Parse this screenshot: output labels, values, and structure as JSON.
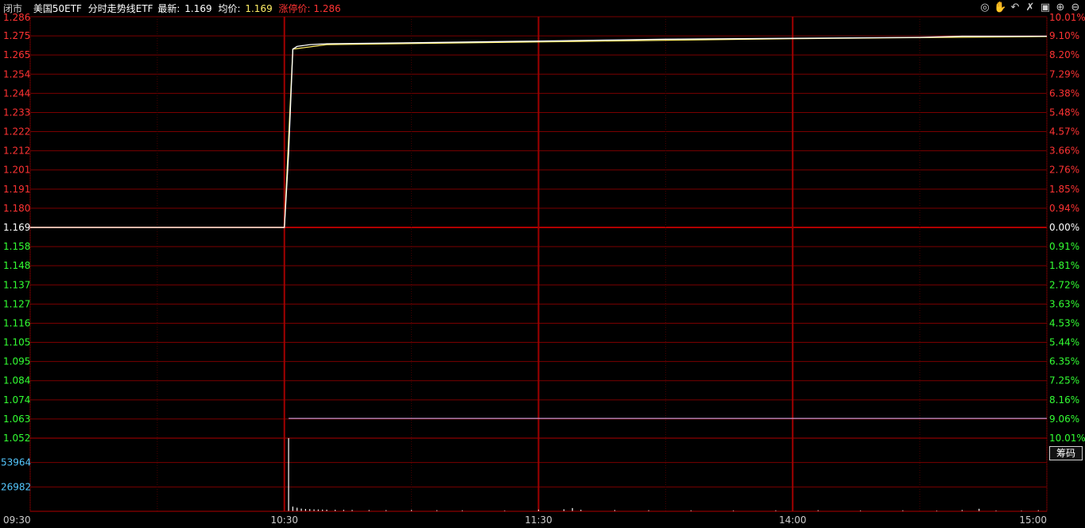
{
  "header": {
    "status": "闭市",
    "name": "美国50ETF",
    "view": "分时走势线ETF",
    "latest_label": "最新:",
    "latest_value": "1.169",
    "avg_label": "均价:",
    "avg_value": "1.169",
    "limit_label": "涨停价:",
    "limit_value": "1.286"
  },
  "toolbar": {
    "icons": [
      "eye-icon",
      "hand-icon",
      "undo-icon",
      "cross-icon",
      "lock-icon",
      "zoom-in-icon",
      "zoom-out-icon"
    ]
  },
  "chip_label": "筹码",
  "colors": {
    "up": "#ff3333",
    "down": "#33ff33",
    "flat": "#ffffff",
    "grid": "#7a0000",
    "price_line": "#ffffff",
    "avg_line": "#ffee66",
    "low_ref": "#d8b8ff",
    "volume_axis": "#55c8ff",
    "volume_bar": "#ffffff"
  },
  "chart_data": {
    "type": "line",
    "prev_close": 1.169,
    "limit_up": 1.286,
    "limit_down": 1.052,
    "price_ticks": [
      "1.286",
      "1.275",
      "1.265",
      "1.254",
      "1.244",
      "1.233",
      "1.222",
      "1.212",
      "1.201",
      "1.191",
      "1.180",
      "1.169",
      "1.158",
      "1.148",
      "1.137",
      "1.127",
      "1.116",
      "1.105",
      "1.095",
      "1.084",
      "1.074",
      "1.063",
      "1.052"
    ],
    "pct_ticks": [
      "10.01%",
      "9.10%",
      "8.20%",
      "7.29%",
      "6.38%",
      "5.48%",
      "4.57%",
      "3.66%",
      "2.76%",
      "1.85%",
      "0.94%",
      "0.00%",
      "0.91%",
      "1.81%",
      "2.72%",
      "3.63%",
      "4.53%",
      "5.44%",
      "6.35%",
      "7.25%",
      "8.16%",
      "9.06%",
      "10.01%"
    ],
    "x_labels": [
      "09:30",
      "10:30",
      "11:30",
      "14:00",
      "15:00"
    ],
    "volume_ticks": [
      "53964",
      "26982"
    ],
    "volume_max": 80946,
    "series": [
      {
        "kind": "price",
        "points": [
          [
            0,
            1.169
          ],
          [
            60,
            1.169
          ],
          [
            61,
            1.21
          ],
          [
            62,
            1.268
          ],
          [
            63,
            1.2695
          ],
          [
            66,
            1.2705
          ],
          [
            70,
            1.271
          ],
          [
            90,
            1.2715
          ],
          [
            120,
            1.2725
          ],
          [
            150,
            1.2735
          ],
          [
            180,
            1.274
          ],
          [
            210,
            1.2745
          ],
          [
            220,
            1.2752
          ],
          [
            240,
            1.2752
          ]
        ]
      },
      {
        "kind": "avg",
        "points": [
          [
            0,
            1.169
          ],
          [
            60,
            1.169
          ],
          [
            62,
            1.268
          ],
          [
            70,
            1.2705
          ],
          [
            120,
            1.272
          ],
          [
            180,
            1.2738
          ],
          [
            240,
            1.275
          ]
        ]
      },
      {
        "kind": "low_ref",
        "points": [
          [
            61,
            1.063
          ],
          [
            240,
            1.063
          ]
        ]
      }
    ],
    "volume": [
      [
        61,
        80946
      ],
      [
        62,
        5200
      ],
      [
        63,
        4000
      ],
      [
        64,
        3000
      ],
      [
        65,
        2600
      ],
      [
        66,
        2400
      ],
      [
        67,
        2100
      ],
      [
        68,
        2000
      ],
      [
        69,
        1900
      ],
      [
        70,
        1800
      ],
      [
        72,
        1700
      ],
      [
        74,
        1600
      ],
      [
        76,
        1500
      ],
      [
        80,
        1400
      ],
      [
        84,
        1300
      ],
      [
        90,
        1500
      ],
      [
        96,
        1200
      ],
      [
        102,
        1100
      ],
      [
        112,
        1000
      ],
      [
        120,
        1800
      ],
      [
        126,
        2200
      ],
      [
        128,
        3600
      ],
      [
        130,
        1700
      ],
      [
        138,
        1400
      ],
      [
        146,
        1200
      ],
      [
        156,
        1100
      ],
      [
        166,
        1000
      ],
      [
        176,
        1100
      ],
      [
        186,
        1200
      ],
      [
        196,
        1000
      ],
      [
        206,
        1100
      ],
      [
        214,
        900
      ],
      [
        220,
        1400
      ],
      [
        224,
        2800
      ],
      [
        228,
        1000
      ],
      [
        234,
        900
      ],
      [
        238,
        1200
      ]
    ]
  }
}
